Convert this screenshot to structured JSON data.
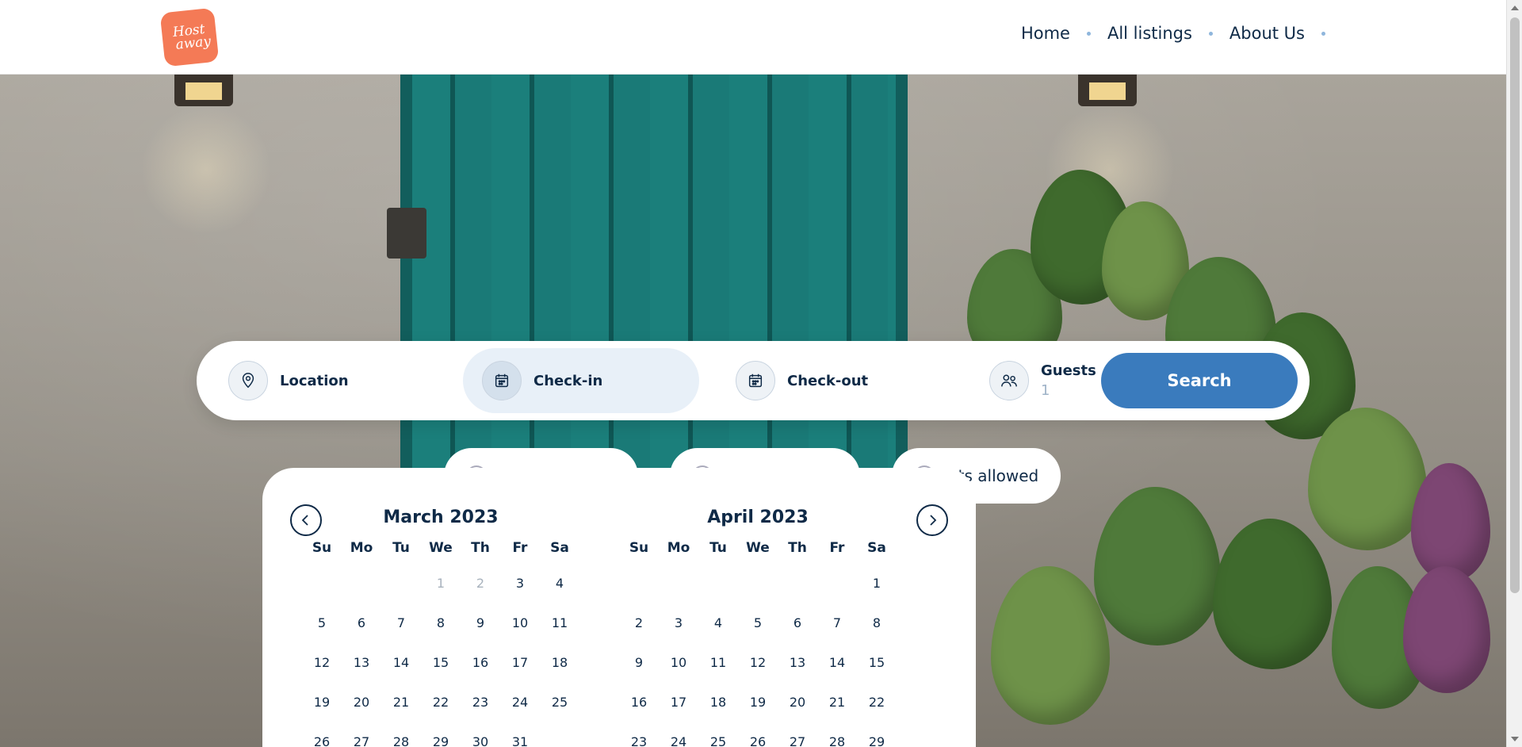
{
  "brand": {
    "logo_line1": "Host",
    "logo_line2": "away",
    "accent": "#f47a56"
  },
  "nav": {
    "items": [
      "Home",
      "All listings",
      "About Us"
    ]
  },
  "search": {
    "location_label": "Location",
    "checkin_label": "Check-in",
    "checkout_label": "Check-out",
    "guests_label": "Guests",
    "guests_value": "1",
    "search_label": "Search",
    "button_color": "#3a7bbd"
  },
  "chips": {
    "pets_label": "Pets allowed"
  },
  "calendar": {
    "weekdays": [
      "Su",
      "Mo",
      "Tu",
      "We",
      "Th",
      "Fr",
      "Sa"
    ],
    "months": [
      {
        "title": "March 2023",
        "days": [
          "",
          "",
          "",
          "1",
          "2",
          "3",
          "4",
          "5",
          "6",
          "7",
          "8",
          "9",
          "10",
          "11",
          "12",
          "13",
          "14",
          "15",
          "16",
          "17",
          "18",
          "19",
          "20",
          "21",
          "22",
          "23",
          "24",
          "25",
          "26",
          "27",
          "28",
          "29",
          "30",
          "31",
          ""
        ],
        "disabled": [
          "1",
          "2"
        ]
      },
      {
        "title": "April 2023",
        "days": [
          "",
          "",
          "",
          "",
          "",
          "",
          "1",
          "2",
          "3",
          "4",
          "5",
          "6",
          "7",
          "8",
          "9",
          "10",
          "11",
          "12",
          "13",
          "14",
          "15",
          "16",
          "17",
          "18",
          "19",
          "20",
          "21",
          "22",
          "23",
          "24",
          "25",
          "26",
          "27",
          "28",
          "29"
        ],
        "disabled": []
      }
    ]
  }
}
